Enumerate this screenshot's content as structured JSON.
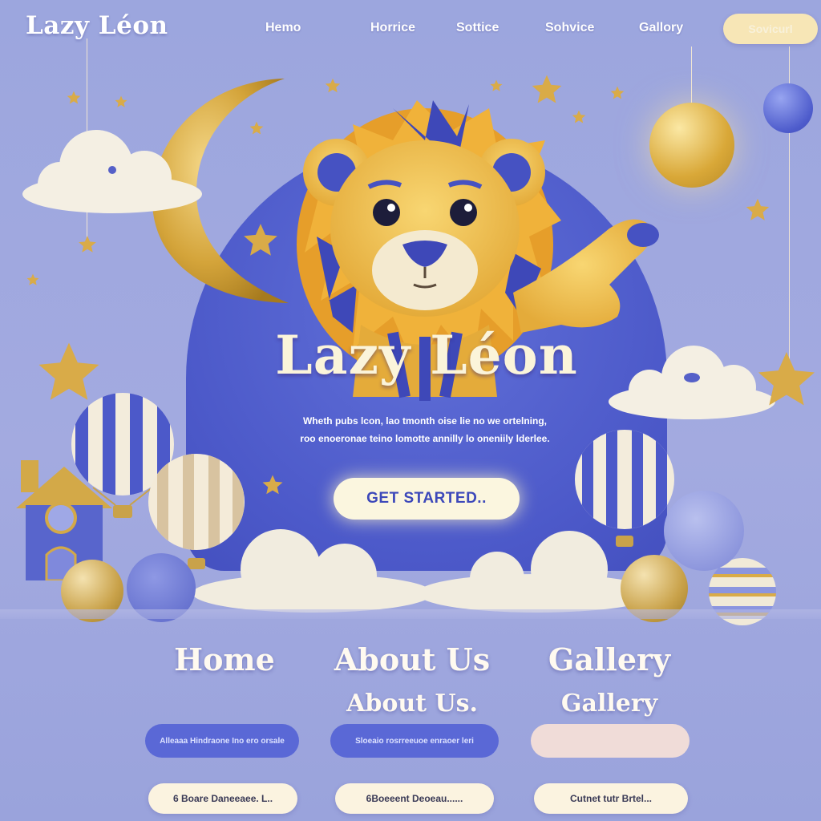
{
  "nav": {
    "brand": "Lazy Léon",
    "links": [
      "Hemo",
      "Horrice",
      "Sottice",
      "Sohvice",
      "Gallory"
    ],
    "cta": "Sovicurl"
  },
  "hero": {
    "title": "Lazy Léon",
    "subtitle_line1": "Wheth pubs lcon, lao tmonth oise lie no we ortelning,",
    "subtitle_line2": "roo enoeronae teino lomotte annilly lo oneniily lderlee.",
    "cta": "GET STARTED.."
  },
  "sections": [
    {
      "title": "Home",
      "subtitle": "",
      "pill": "Alleaaa Hindraone Ino ero orsale",
      "button": "6 Boare Daneeaee. L.."
    },
    {
      "title": "About Us",
      "subtitle": "About Us.",
      "pill": "Sloeaio rosrreeuoe enraoer leri",
      "button": "6Boeeent Deoeau......"
    },
    {
      "title": "Gallery",
      "subtitle": "Gallery",
      "pill": "",
      "button": "Cutnet tutr Brtel..."
    }
  ],
  "colors": {
    "background": "#9ca6de",
    "accent_blue": "#4c59c9",
    "gold": "#d9ab48",
    "cream": "#fbf6df"
  }
}
